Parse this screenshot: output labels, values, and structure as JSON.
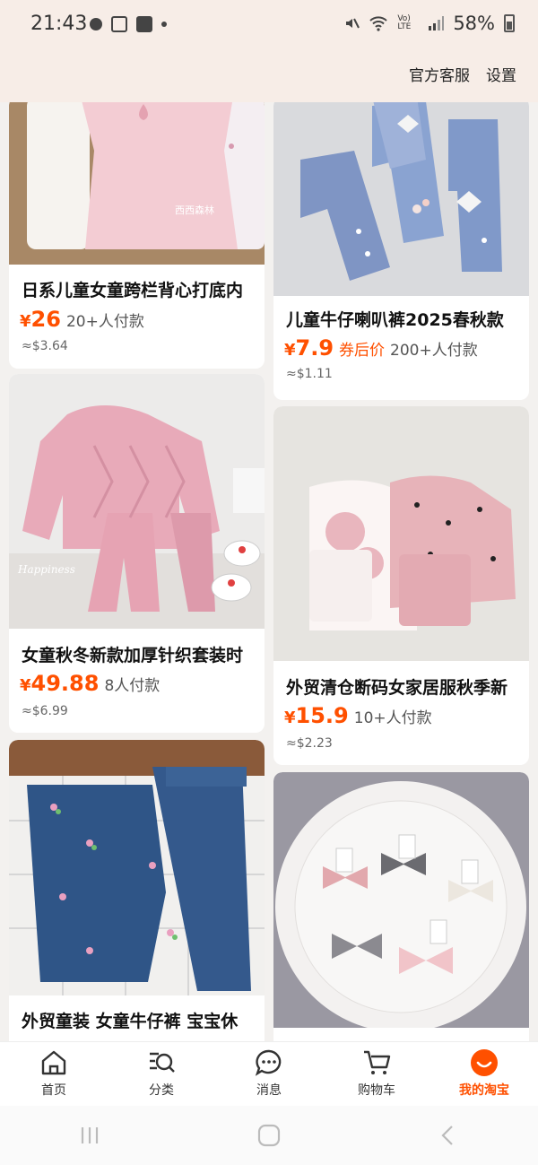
{
  "status_bar": {
    "time": "21:43",
    "network_label": "Vo) LTE",
    "battery": "58%"
  },
  "header": {
    "customer_service": "官方客服",
    "settings": "设置"
  },
  "products": [
    {
      "title": "日系儿童女童跨栏背心打底内",
      "currency": "¥",
      "price": "26",
      "coupon": "",
      "buyers": "20+人付款",
      "usd": "≈$3.64",
      "watermark": "西西森林"
    },
    {
      "title": "儿童牛仔喇叭裤2025春秋款",
      "currency": "¥",
      "price": "7.9",
      "coupon": "券后价",
      "buyers": "200+人付款",
      "usd": "≈$1.11"
    },
    {
      "title": "女童秋冬新款加厚针织套装时",
      "currency": "¥",
      "price": "49.88",
      "coupon": "",
      "buyers": "8人付款",
      "usd": "≈$6.99",
      "watermark": "Happiness"
    },
    {
      "title": "外贸清仓断码女家居服秋季新",
      "currency": "¥",
      "price": "15.9",
      "coupon": "",
      "buyers": "10+人付款",
      "usd": "≈$2.23"
    },
    {
      "title": "外贸童装 女童牛仔裤 宝宝休"
    },
    {
      "title": ""
    }
  ],
  "tabs": [
    {
      "label": "首页",
      "icon": "home-icon"
    },
    {
      "label": "分类",
      "icon": "category-search-icon"
    },
    {
      "label": "消息",
      "icon": "message-icon"
    },
    {
      "label": "购物车",
      "icon": "cart-icon"
    },
    {
      "label": "我的淘宝",
      "icon": "my-taobao-icon",
      "active": true
    }
  ],
  "colors": {
    "accent": "#ff5000",
    "header_bg": "#f7ede7",
    "page_bg": "#f3f1ef"
  }
}
